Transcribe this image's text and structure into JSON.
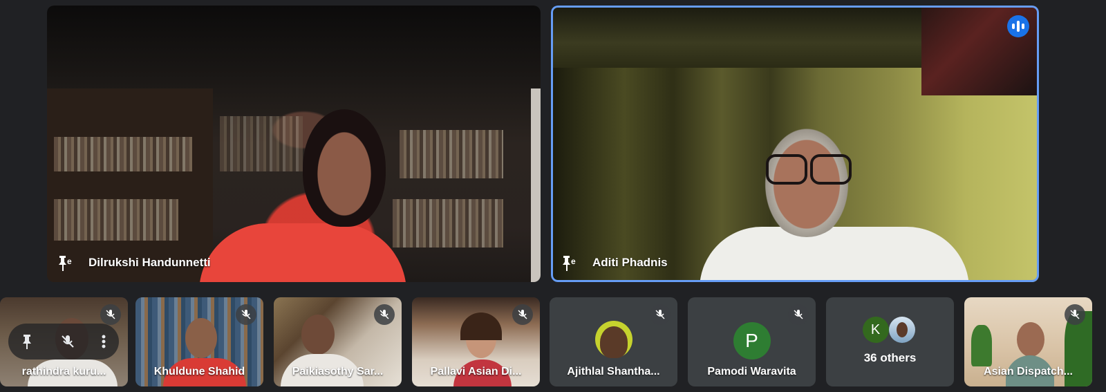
{
  "main_tiles": [
    {
      "name": "Dilrukshi Handunnetti",
      "pinned_icon": "pin-icon"
    },
    {
      "name": "Aditi Phadnis",
      "pinned_icon": "pin-icon",
      "speaking": true
    }
  ],
  "small_tiles": [
    {
      "name": "rathindra kuru...",
      "muted": true
    },
    {
      "name": "Khuldune Shahid",
      "muted": true
    },
    {
      "name": "Paikiasothy Sar...",
      "muted": true
    },
    {
      "name": "Pallavi Asian Di...",
      "muted": true
    },
    {
      "name": "Ajithlal Shantha...",
      "muted": true
    },
    {
      "name": "Pamodi Waravita",
      "muted": true,
      "avatar_letter": "P",
      "avatar_color": "#2e7d32"
    },
    {
      "name": "36 others",
      "avatar_letter": "K",
      "avatar_color": "#33691e"
    },
    {
      "name": "Asian Dispatch...",
      "muted": true
    }
  ],
  "colors": {
    "background": "#202124",
    "tile": "#3c4043",
    "speaking_border": "#669df6",
    "speaking_badge": "#1a73e8"
  }
}
